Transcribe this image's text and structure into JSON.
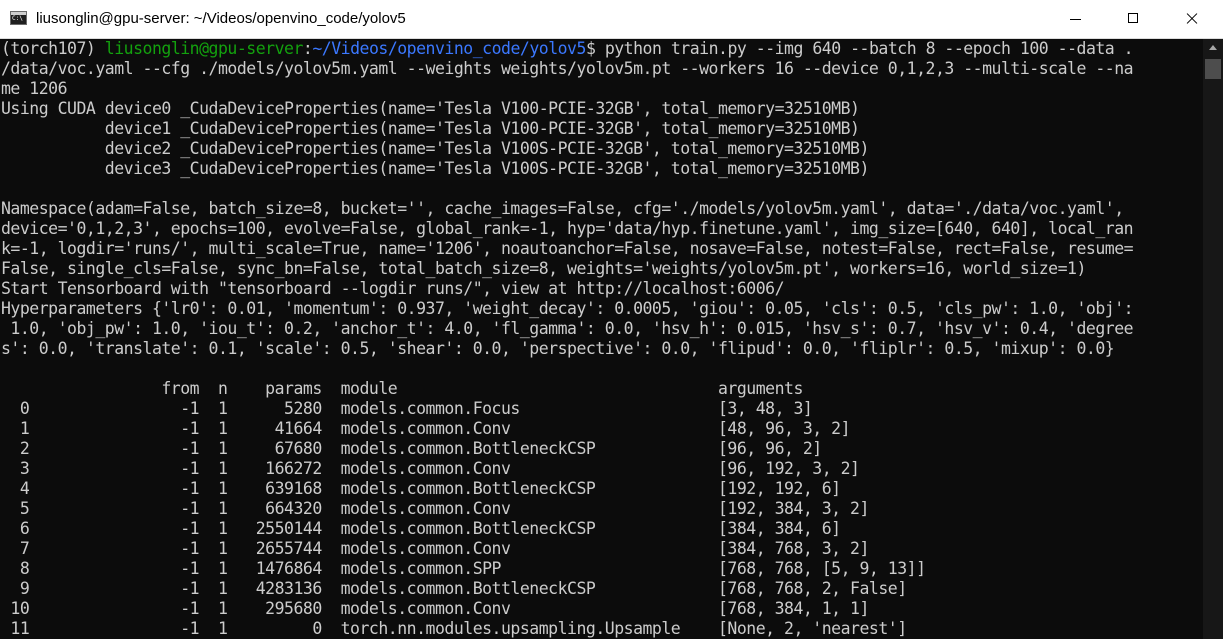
{
  "window": {
    "title": "liusonglin@gpu-server: ~/Videos/openvino_code/yolov5",
    "icon": "console-icon",
    "controls": [
      "minimize-icon",
      "maximize-icon",
      "close-icon"
    ]
  },
  "colors": {
    "background": "#0c0c0c",
    "text": "#cccccc",
    "prompt_user": "#13a10e",
    "prompt_path": "#3b78ff",
    "titlebar": "#ffffff"
  },
  "prompt": {
    "env": "(torch107) ",
    "user_host": "liusonglin@gpu-server",
    "sep": ":",
    "path": "~/Videos/openvino_code/yolov5",
    "symbol": "$ ",
    "command_part1": "python train.py --img 640 --batch 8 --epoch 100 --data .",
    "command_part2": "/data/voc.yaml --cfg ./models/yolov5m.yaml --weights weights/yolov5m.pt --workers 16 --device 0,1,2,3 --multi-scale --na",
    "command_part3": "me 1206"
  },
  "output_lines": [
    "Using CUDA device0 _CudaDeviceProperties(name='Tesla V100-PCIE-32GB', total_memory=32510MB)",
    "           device1 _CudaDeviceProperties(name='Tesla V100-PCIE-32GB', total_memory=32510MB)",
    "           device2 _CudaDeviceProperties(name='Tesla V100S-PCIE-32GB', total_memory=32510MB)",
    "           device3 _CudaDeviceProperties(name='Tesla V100S-PCIE-32GB', total_memory=32510MB)",
    "",
    "Namespace(adam=False, batch_size=8, bucket='', cache_images=False, cfg='./models/yolov5m.yaml', data='./data/voc.yaml',",
    "device='0,1,2,3', epochs=100, evolve=False, global_rank=-1, hyp='data/hyp.finetune.yaml', img_size=[640, 640], local_ran",
    "k=-1, logdir='runs/', multi_scale=True, name='1206', noautoanchor=False, nosave=False, notest=False, rect=False, resume=",
    "False, single_cls=False, sync_bn=False, total_batch_size=8, weights='weights/yolov5m.pt', workers=16, world_size=1)",
    "Start Tensorboard with \"tensorboard --logdir runs/\", view at http://localhost:6006/",
    "Hyperparameters {'lr0': 0.01, 'momentum': 0.937, 'weight_decay': 0.0005, 'giou': 0.05, 'cls': 0.5, 'cls_pw': 1.0, 'obj':",
    " 1.0, 'obj_pw': 1.0, 'iou_t': 0.2, 'anchor_t': 4.0, 'fl_gamma': 0.0, 'hsv_h': 0.015, 'hsv_s': 0.7, 'hsv_v': 0.4, 'degree",
    "s': 0.0, 'translate': 0.1, 'scale': 0.5, 'shear': 0.0, 'perspective': 0.0, 'flipud': 0.0, 'fliplr': 0.5, 'mixup': 0.0}",
    "",
    "                 from  n    params  module                                  arguments",
    "  0                -1  1      5280  models.common.Focus                     [3, 48, 3]",
    "  1                -1  1     41664  models.common.Conv                      [48, 96, 3, 2]",
    "  2                -1  1     67680  models.common.BottleneckCSP             [96, 96, 2]",
    "  3                -1  1    166272  models.common.Conv                      [96, 192, 3, 2]",
    "  4                -1  1    639168  models.common.BottleneckCSP             [192, 192, 6]",
    "  5                -1  1    664320  models.common.Conv                      [192, 384, 3, 2]",
    "  6                -1  1   2550144  models.common.BottleneckCSP             [384, 384, 6]",
    "  7                -1  1   2655744  models.common.Conv                      [384, 768, 3, 2]",
    "  8                -1  1   1476864  models.common.SPP                       [768, 768, [5, 9, 13]]",
    "  9                -1  1   4283136  models.common.BottleneckCSP             [768, 768, 2, False]",
    " 10                -1  1    295680  models.common.Conv                      [768, 384, 1, 1]",
    " 11                -1  1         0  torch.nn.modules.upsampling.Upsample    [None, 2, 'nearest']"
  ]
}
